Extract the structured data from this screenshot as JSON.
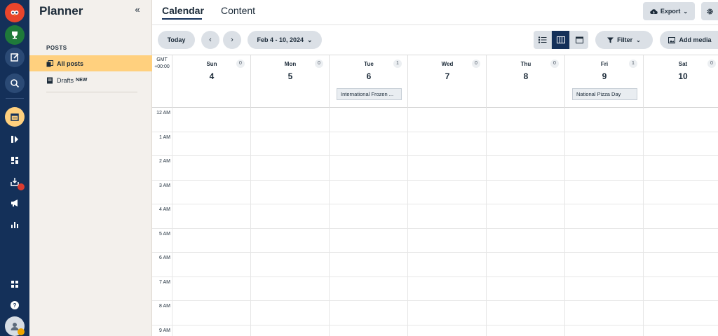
{
  "colors": {
    "rail": "#143059",
    "sidebar": "#f3f0ec",
    "active_nav": "#ffd07e",
    "button": "#dbe0e6",
    "view_active": "#143059"
  },
  "rail": {
    "icons": [
      "owl-logo-icon",
      "trophy-icon",
      "compose-icon",
      "search-icon",
      "calendar-icon",
      "streams-icon",
      "dashboard-icon",
      "inbox-icon",
      "megaphone-icon",
      "analytics-icon",
      "apps-icon",
      "help-icon",
      "profile-icon"
    ]
  },
  "sidebar": {
    "title": "Planner",
    "section_label": "POSTS",
    "items": [
      {
        "label": "All posts",
        "active": true
      },
      {
        "label": "Drafts",
        "badge": "NEW"
      }
    ]
  },
  "header": {
    "tabs": [
      {
        "label": "Calendar"
      },
      {
        "label": "Content"
      }
    ],
    "export_label": "Export"
  },
  "toolbar": {
    "today_label": "Today",
    "date_range": "Feb 4 - 10, 2024",
    "filter_label": "Filter",
    "add_media_label": "Add media"
  },
  "calendar": {
    "tz_line1": "GMT",
    "tz_line2": "+00:00",
    "days": [
      {
        "name": "Sun",
        "num": "4",
        "count": "0"
      },
      {
        "name": "Mon",
        "num": "5",
        "count": "0"
      },
      {
        "name": "Tue",
        "num": "6",
        "count": "1",
        "event": "International Frozen ..."
      },
      {
        "name": "Wed",
        "num": "7",
        "count": "0"
      },
      {
        "name": "Thu",
        "num": "8",
        "count": "0"
      },
      {
        "name": "Fri",
        "num": "9",
        "count": "1",
        "event": "National Pizza Day"
      },
      {
        "name": "Sat",
        "num": "10",
        "count": "0"
      }
    ],
    "hours": [
      "12 AM",
      "1 AM",
      "2 AM",
      "3 AM",
      "4 AM",
      "5 AM",
      "6 AM",
      "7 AM",
      "8 AM",
      "9 AM"
    ]
  }
}
